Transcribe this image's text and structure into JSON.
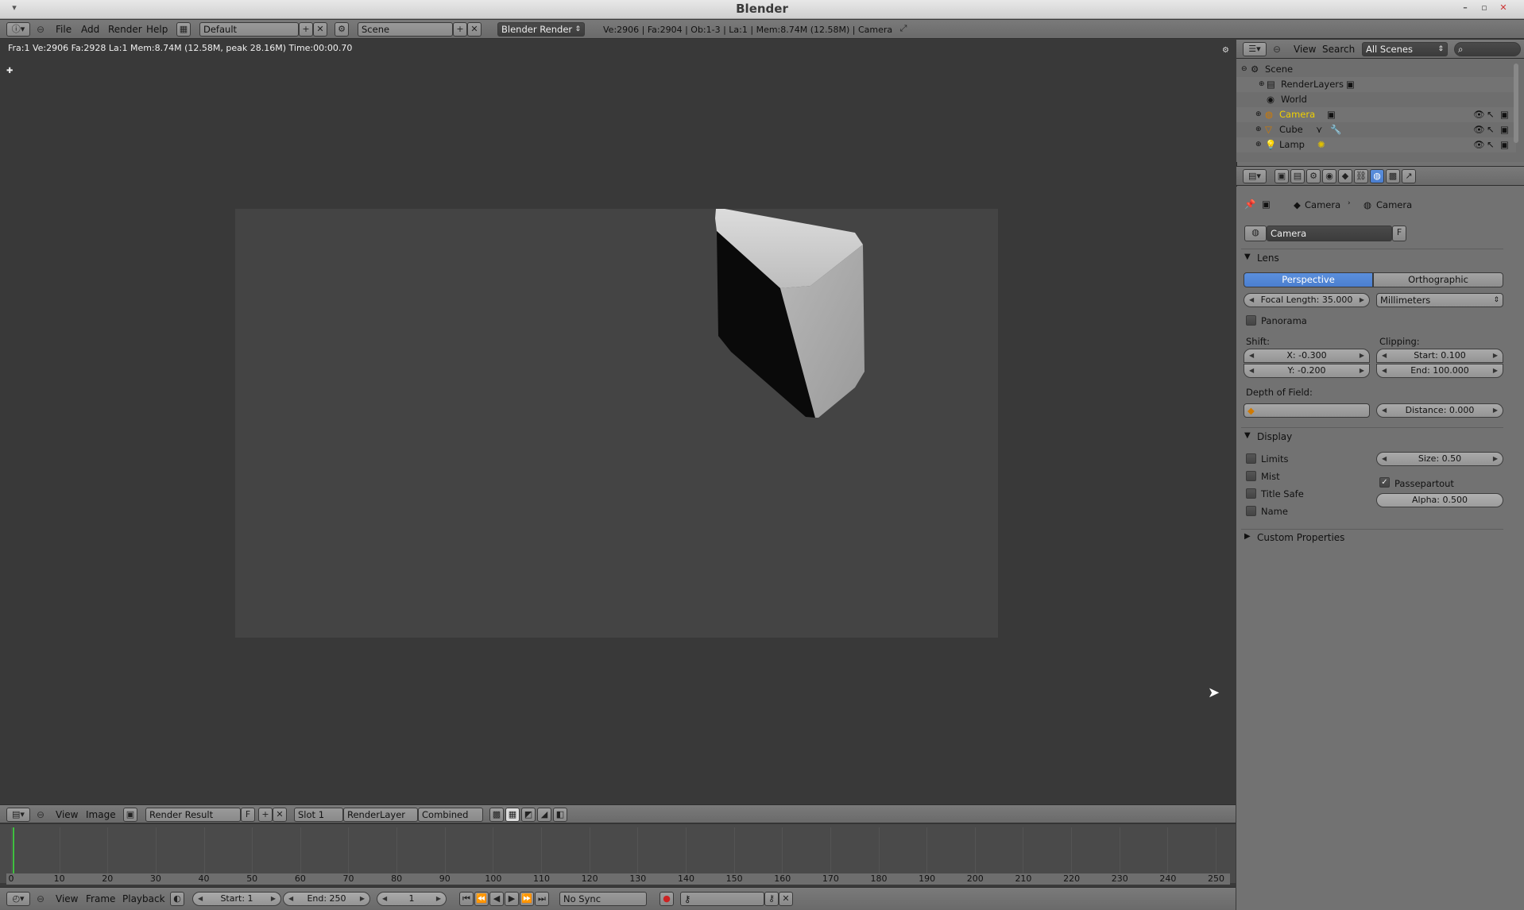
{
  "window": {
    "title": "Blender"
  },
  "top": {
    "menus": [
      "File",
      "Add",
      "Render",
      "Help"
    ],
    "layout": "Default",
    "scene": "Scene",
    "engine": "Blender Render",
    "stats": "Ve:2906 | Fa:2904 | Ob:1-3 | La:1 | Mem:8.74M (12.58M) | Camera"
  },
  "viewport": {
    "info": "Fra:1  Ve:2906 Fa:2928 La:1 Mem:8.74M (12.58M, peak 28.16M) Time:00:00.70"
  },
  "image_header": {
    "menus": [
      "View",
      "Image"
    ],
    "image_name": "Render Result",
    "fake_user": "F",
    "slot": "Slot 1",
    "layer": "RenderLayer",
    "pass": "Combined"
  },
  "timeline": {
    "ticks": [
      "0",
      "10",
      "20",
      "30",
      "40",
      "50",
      "60",
      "70",
      "80",
      "90",
      "100",
      "110",
      "120",
      "130",
      "140",
      "150",
      "160",
      "170",
      "180",
      "190",
      "200",
      "210",
      "220",
      "230",
      "240",
      "250"
    ],
    "menus": [
      "View",
      "Frame",
      "Playback"
    ],
    "start": "Start: 1",
    "end": "End: 250",
    "current": "1",
    "sync": "No Sync"
  },
  "outliner": {
    "menus": [
      "View",
      "Search"
    ],
    "filter": "All Scenes",
    "items": [
      {
        "label": "Scene",
        "icon": "scene-icon"
      },
      {
        "label": "RenderLayers",
        "icon": "renderlayers-icon"
      },
      {
        "label": "World",
        "icon": "world-icon"
      },
      {
        "label": "Camera",
        "icon": "camera-icon"
      },
      {
        "label": "Cube",
        "icon": "mesh-icon"
      },
      {
        "label": "Lamp",
        "icon": "lamp-icon"
      }
    ]
  },
  "properties": {
    "breadcrumb": [
      "Camera",
      "Camera"
    ],
    "datablock": "Camera",
    "datablock_fake": "F",
    "lens": {
      "title": "Lens",
      "perspective": "Perspective",
      "orthographic": "Orthographic",
      "focal_length": "Focal Length: 35.000",
      "units": "Millimeters",
      "panorama": "Panorama",
      "shift_label": "Shift:",
      "shift_x": "X: -0.300",
      "shift_y": "Y: -0.200",
      "clipping_label": "Clipping:",
      "clip_start": "Start: 0.100",
      "clip_end": "End: 100.000",
      "dof_label": "Depth of Field:",
      "dof_distance": "Distance: 0.000"
    },
    "display": {
      "title": "Display",
      "limits": "Limits",
      "mist": "Mist",
      "title_safe": "Title Safe",
      "name": "Name",
      "size": "Size: 0.50",
      "passepartout": "Passepartout",
      "alpha": "Alpha: 0.500"
    },
    "custom_properties": "Custom Properties"
  },
  "colors": {
    "accent": "#5680d6",
    "viewport": "#393939",
    "panel": "#727272"
  }
}
